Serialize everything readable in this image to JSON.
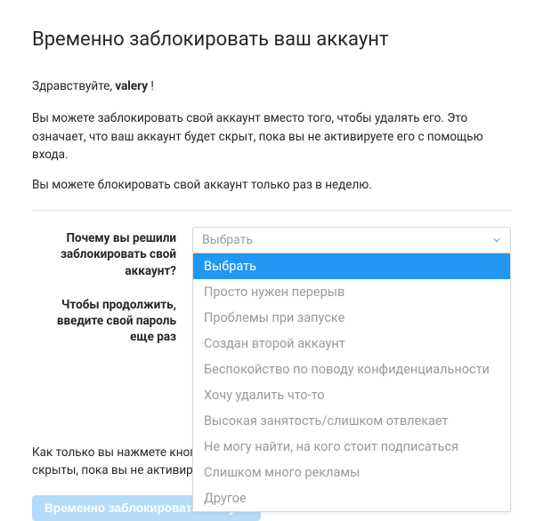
{
  "heading": "Временно заблокировать ваш аккаунт",
  "greeting_prefix": "Здравствуйте, ",
  "username": "valery",
  "greeting_suffix": " !",
  "para1": "Вы можете заблокировать свой аккаунт вместо того, чтобы удалять его. Это означает, что ваш аккаунт будет скрыт, пока вы не активируете его с помощью входа.",
  "para2": "Вы можете блокировать свой аккаунт только раз в неделю.",
  "form": {
    "reason_label": "Почему вы решили заблокировать свой аккаунт?",
    "password_label": "Чтобы продолжить, введите свой пароль еще раз",
    "select_placeholder": "Выбрать",
    "options": [
      "Выбрать",
      "Просто нужен перерыв",
      "Проблемы при запуске",
      "Создан второй аккаунт",
      "Беспокойство по поводу конфиденциальности",
      "Хочу удалить что-то",
      "Высокая занятость/слишком отвлекает",
      "Не могу найти, на кого стоит подписаться",
      "Слишком много рекламы",
      "Другое"
    ]
  },
  "footer": {
    "line1": "Как только вы нажмете кнопку ниж",
    "line2": "скрыты, пока вы не активируете све"
  },
  "submit_label": "Временно заблокировать аккаунт"
}
